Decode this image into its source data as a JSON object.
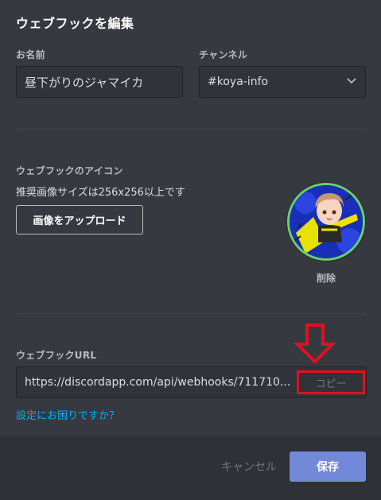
{
  "dialog": {
    "title": "ウェブフックを編集"
  },
  "name_field": {
    "label": "お名前",
    "value": "昼下がりのジャマイカ"
  },
  "channel_field": {
    "label": "チャンネル",
    "value": "#koya-info"
  },
  "icon_section": {
    "label": "ウェブフックのアイコン",
    "hint": "推奨画像サイズは256x256以上です",
    "upload_label": "画像をアップロード",
    "delete_label": "削除"
  },
  "url_section": {
    "label": "ウェブフックURL",
    "value": "https://discordapp.com/api/webhooks/711710...",
    "copy_label": "コピー",
    "help_link": "設定にお困りですか？"
  },
  "footer": {
    "cancel_label": "キャンセル",
    "save_label": "保存"
  },
  "colors": {
    "background": "#36393f",
    "footer": "#2f3136",
    "accent": "#7289da",
    "link": "#00b0f4",
    "annotation_red": "#e01020"
  }
}
